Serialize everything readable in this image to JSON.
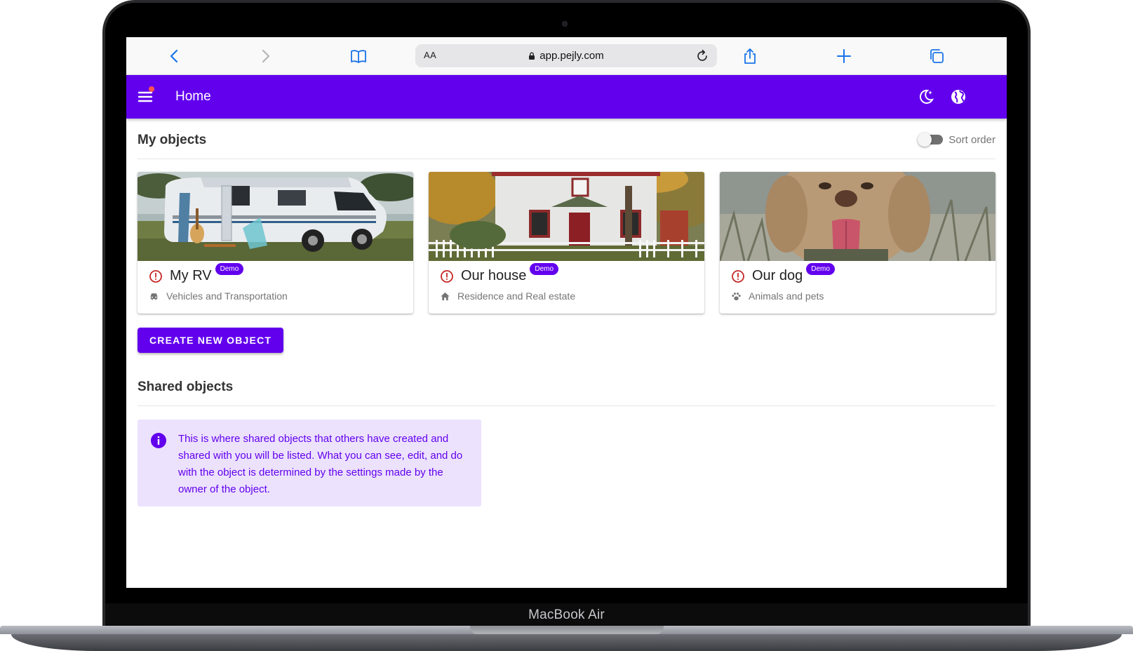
{
  "device": {
    "brand_label": "MacBook Air"
  },
  "browser": {
    "aa_label": "AA",
    "url": "app.pejly.com",
    "icons": [
      "back-icon",
      "forward-icon",
      "bookmarks-icon",
      "lock-icon",
      "reload-icon",
      "share-icon",
      "new-tab-icon",
      "tabs-icon"
    ]
  },
  "appbar": {
    "title": "Home",
    "color": "#6200ee",
    "icons": [
      "menu-icon",
      "dark-mode-icon",
      "language-globe-icon"
    ]
  },
  "my_objects": {
    "heading": "My objects",
    "sort_label": "Sort order",
    "sort_enabled": false,
    "cards": [
      {
        "title": "My RV",
        "badge": "Demo",
        "category": "Vehicles and Transportation",
        "category_icon": "car-icon",
        "status_icon": "warning-circle-icon"
      },
      {
        "title": "Our house",
        "badge": "Demo",
        "category": "Residence and Real estate",
        "category_icon": "home-icon",
        "status_icon": "warning-circle-icon"
      },
      {
        "title": "Our dog",
        "badge": "Demo",
        "category": "Animals and pets",
        "category_icon": "paw-icon",
        "status_icon": "warning-circle-icon"
      }
    ],
    "create_button": "CREATE NEW OBJECT"
  },
  "shared_objects": {
    "heading": "Shared objects",
    "info": "This is where shared objects that others have created and shared with you will be listed. What you can see, edit, and do with the object is determined by the settings made by the owner of the object."
  },
  "colors": {
    "accent": "#6200ee",
    "warning": "#c62828",
    "info_bg": "#ece2fd"
  }
}
